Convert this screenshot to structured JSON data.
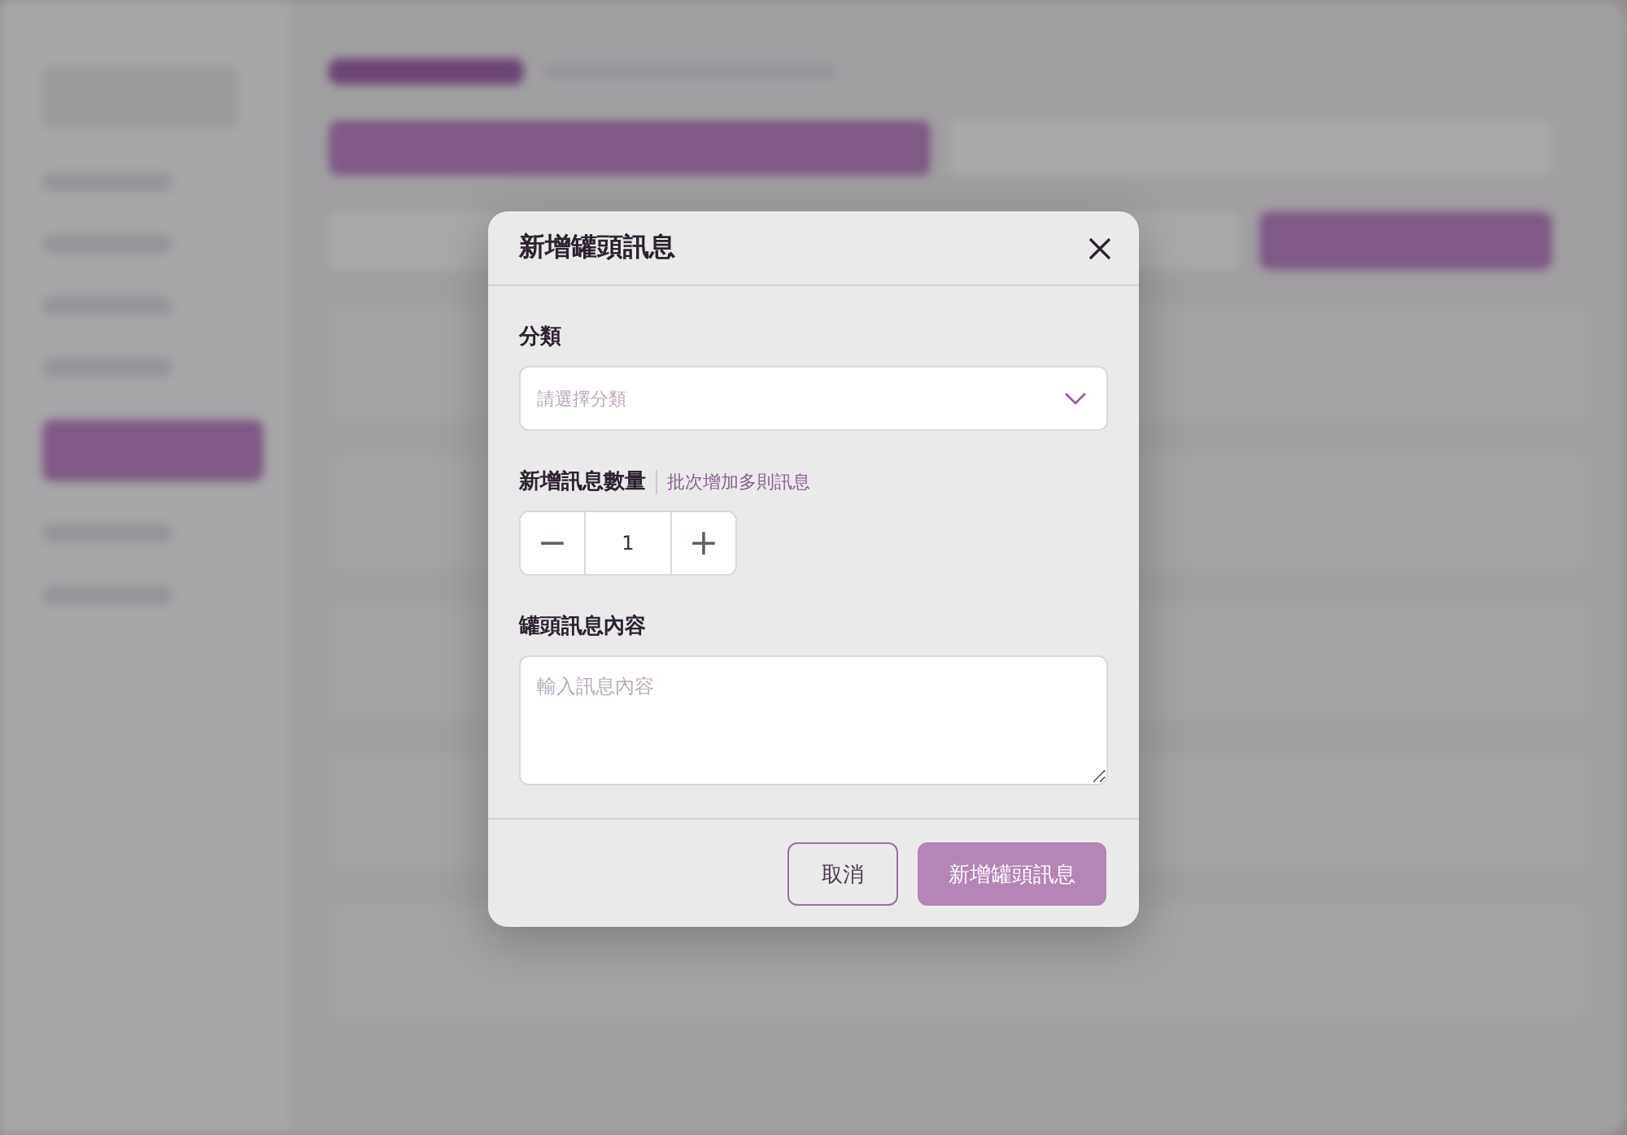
{
  "dialog": {
    "title": "新增罐頭訊息",
    "category": {
      "label": "分類",
      "placeholder": "請選擇分類"
    },
    "quantity": {
      "label": "新增訊息數量",
      "hint": "批次增加多則訊息",
      "minus": "−",
      "value": "1",
      "plus": "+"
    },
    "content": {
      "label": "罐頭訊息內容",
      "placeholder": "輸入訊息內容"
    },
    "buttons": [
      {
        "label": "取消",
        "kind": "secondary"
      },
      {
        "label": "新增罐頭訊息",
        "kind": "primary"
      }
    ]
  }
}
